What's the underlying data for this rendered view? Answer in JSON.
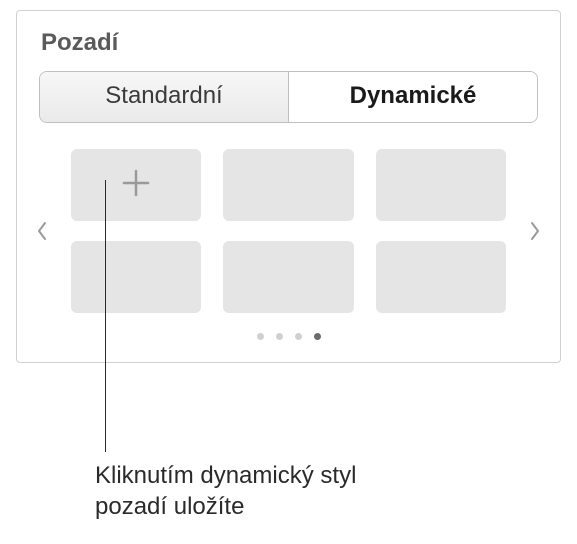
{
  "section": {
    "title": "Pozadí"
  },
  "tabs": {
    "standard": "Standardní",
    "dynamic": "Dynamické",
    "active": "dynamic"
  },
  "grid": {
    "rows": 2,
    "cols": 3,
    "add_icon": "plus-icon"
  },
  "pagination": {
    "count": 4,
    "current": 4
  },
  "callout": {
    "text": "Kliknutím dynamický styl pozadí uložíte"
  }
}
